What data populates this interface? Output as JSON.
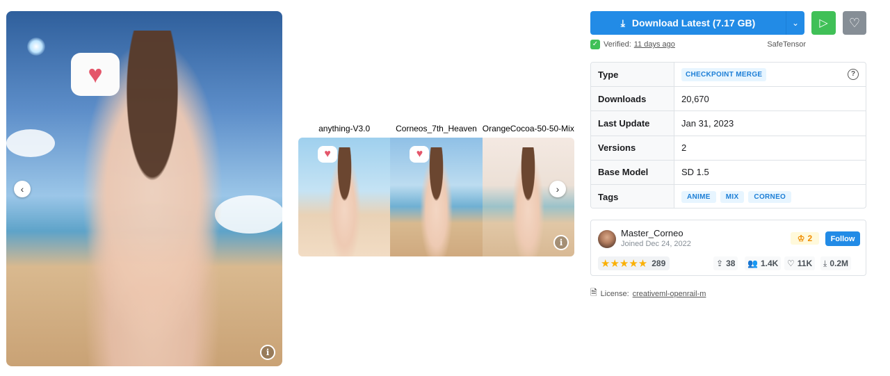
{
  "gallery": {
    "main": {
      "prev_glyph": "‹",
      "info_glyph": "i",
      "bubble_glyph": "♥"
    },
    "compare": {
      "labels": [
        "anything-V3.0",
        "Corneos_7th_Heaven",
        "OrangeCocoa-50-50-Mix"
      ],
      "next_glyph": "›",
      "info_glyph": "i"
    }
  },
  "download": {
    "label": "Download Latest (7.17 GB)",
    "download_icon": "⤓",
    "caret_icon": "⌄",
    "play_icon": "▷",
    "like_icon": "♡"
  },
  "verified": {
    "label": "Verified:",
    "age": "11 days ago",
    "format": "SafeTensor",
    "shield_icon": "✓"
  },
  "details": {
    "type_label": "Type",
    "type_value": "CHECKPOINT MERGE",
    "help_icon": "?",
    "downloads_label": "Downloads",
    "downloads_value": "20,670",
    "last_update_label": "Last Update",
    "last_update_value": "Jan 31, 2023",
    "versions_label": "Versions",
    "versions_value": "2",
    "base_model_label": "Base Model",
    "base_model_value": "SD 1.5",
    "tags_label": "Tags",
    "tags": [
      "ANIME",
      "MIX",
      "CORNEO"
    ]
  },
  "creator": {
    "name": "Master_Corneo",
    "joined": "Joined Dec 24, 2022",
    "crown_icon": "♔",
    "rank": "2",
    "follow_label": "Follow",
    "stars_glyph": "★★★★★",
    "rating_count": "289",
    "uploads_icon": "⇪",
    "uploads": "38",
    "followers_icon": "👥",
    "followers": "1.4K",
    "likes_icon": "♡",
    "likes": "11K",
    "downloads_icon": "⤓",
    "downloads": "0.2M"
  },
  "license": {
    "label": "License:",
    "value": "creativeml-openrail-m",
    "doc_icon": "🗎"
  },
  "colors": {
    "primary": "#228be6",
    "success": "#40c057",
    "neutral": "#868e96",
    "badge_bg": "#e7f5ff",
    "badge_text": "#1c7ed6",
    "star": "#fab005"
  }
}
